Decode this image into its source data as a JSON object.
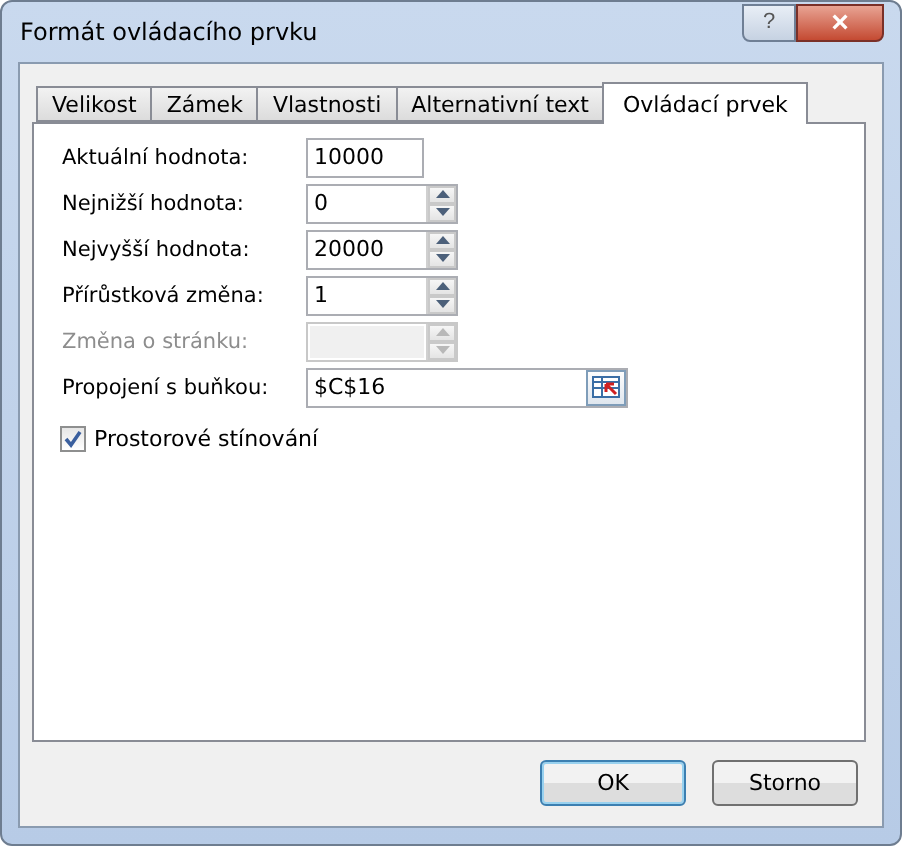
{
  "window": {
    "title": "Formát ovládacího prvku",
    "help": "?",
    "close": "×"
  },
  "tabs": [
    {
      "label": "Velikost",
      "selected": false
    },
    {
      "label": "Zámek",
      "selected": false
    },
    {
      "label": "Vlastnosti",
      "selected": false
    },
    {
      "label": "Alternativní text",
      "selected": false
    },
    {
      "label": "Ovládací prvek",
      "selected": true
    }
  ],
  "fields": [
    {
      "kind": "text",
      "label": "Aktuální hodnota:",
      "value": "10000",
      "disabled": false
    },
    {
      "kind": "spin",
      "label": "Nejnižší hodnota:",
      "value": "0",
      "disabled": false
    },
    {
      "kind": "spin",
      "label": "Nejvyšší hodnota:",
      "value": "20000",
      "disabled": false
    },
    {
      "kind": "spin",
      "label": "Přírůstková změna:",
      "value": "1",
      "disabled": false
    },
    {
      "kind": "spin",
      "label": "Změna o stránku:",
      "disabled": true
    },
    {
      "kind": "link",
      "label": "Propojení s buňkou:",
      "value": "$C$16",
      "disabled": false
    }
  ],
  "shading": {
    "label": "Prostorové stínování",
    "checked": true
  },
  "buttons": [
    {
      "label": "OK",
      "default": true
    },
    {
      "label": "Storno",
      "default": false
    }
  ]
}
